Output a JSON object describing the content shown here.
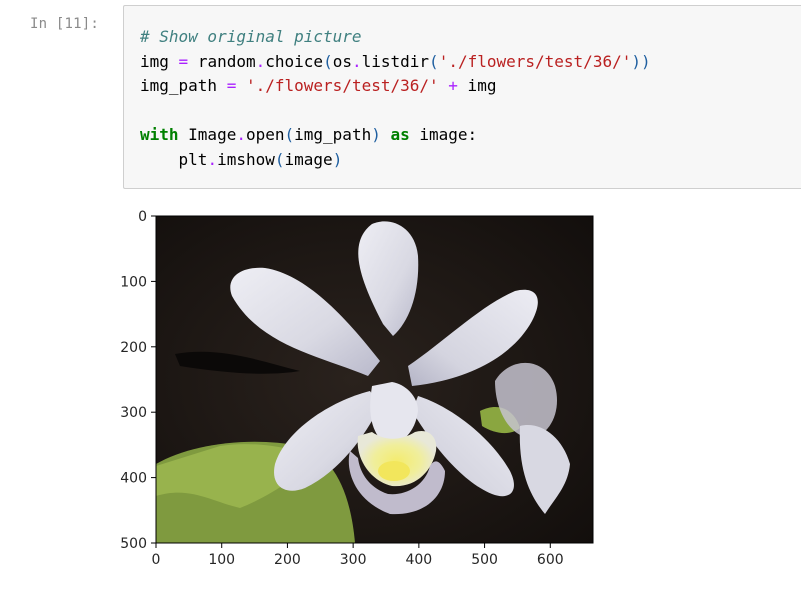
{
  "cell": {
    "prompt": "In [11]:",
    "code_lines": [
      [
        {
          "t": "# Show original picture",
          "k": "comment"
        }
      ],
      [
        {
          "t": "img",
          "k": "name"
        },
        {
          "t": " ",
          "k": "name"
        },
        {
          "t": "=",
          "k": "op"
        },
        {
          "t": " random",
          "k": "name"
        },
        {
          "t": ".",
          "k": "op"
        },
        {
          "t": "choice",
          "k": "name"
        },
        {
          "t": "(",
          "k": "paren"
        },
        {
          "t": "os",
          "k": "name"
        },
        {
          "t": ".",
          "k": "op"
        },
        {
          "t": "listdir",
          "k": "name"
        },
        {
          "t": "(",
          "k": "paren"
        },
        {
          "t": "'./flowers/test/36/'",
          "k": "str"
        },
        {
          "t": "))",
          "k": "paren"
        }
      ],
      [
        {
          "t": "img_path",
          "k": "name"
        },
        {
          "t": " ",
          "k": "name"
        },
        {
          "t": "=",
          "k": "op"
        },
        {
          "t": " ",
          "k": "name"
        },
        {
          "t": "'./flowers/test/36/'",
          "k": "str"
        },
        {
          "t": " ",
          "k": "name"
        },
        {
          "t": "+",
          "k": "op"
        },
        {
          "t": " img",
          "k": "name"
        }
      ],
      [],
      [
        {
          "t": "with",
          "k": "kw"
        },
        {
          "t": " Image",
          "k": "name"
        },
        {
          "t": ".",
          "k": "op"
        },
        {
          "t": "open",
          "k": "name"
        },
        {
          "t": "(",
          "k": "paren"
        },
        {
          "t": "img_path",
          "k": "name"
        },
        {
          "t": ")",
          "k": "paren"
        },
        {
          "t": " ",
          "k": "name"
        },
        {
          "t": "as",
          "k": "kw"
        },
        {
          "t": " image:",
          "k": "name"
        }
      ],
      [
        {
          "t": "    plt",
          "k": "name"
        },
        {
          "t": ".",
          "k": "op"
        },
        {
          "t": "imshow",
          "k": "name"
        },
        {
          "t": "(",
          "k": "paren"
        },
        {
          "t": "image",
          "k": "name"
        },
        {
          "t": ")",
          "k": "paren"
        }
      ]
    ]
  },
  "output": {
    "image_subject": "white orchid flower on dark background",
    "x_ticks": [
      "0",
      "100",
      "200",
      "300",
      "400",
      "500",
      "600"
    ],
    "y_ticks": [
      "0",
      "100",
      "200",
      "300",
      "400",
      "500"
    ],
    "x_range": [
      0,
      665
    ],
    "y_range": [
      0,
      500
    ],
    "colors": {
      "background": "#1a1512",
      "petal": "#e2e2ea",
      "petal_shade": "#b8b8c8",
      "lip_yellow": "#f2e86a",
      "leaf_green": "#8fa84a"
    }
  }
}
